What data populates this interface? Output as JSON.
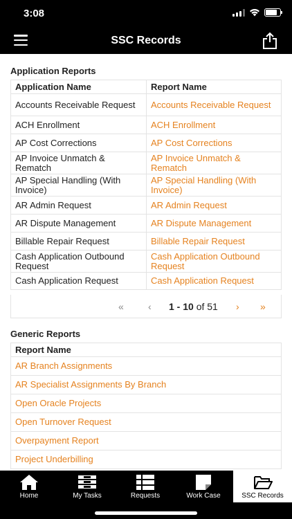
{
  "status": {
    "time": "3:08"
  },
  "nav": {
    "title": "SSC Records"
  },
  "app_reports": {
    "title": "Application Reports",
    "columns": [
      "Application Name",
      "Report Name"
    ],
    "rows": [
      [
        "Accounts Receivable Request",
        "Accounts Receivable Request"
      ],
      [
        "ACH Enrollment",
        "ACH Enrollment"
      ],
      [
        "AP Cost Corrections",
        "AP Cost Corrections"
      ],
      [
        "AP Invoice Unmatch & Rematch",
        "AP Invoice Unmatch & Rematch"
      ],
      [
        "AP Special Handling (With Invoice)",
        "AP Special Handling (With Invoice)"
      ],
      [
        "AR Admin Request",
        "AR Admin Request"
      ],
      [
        "AR Dispute Management",
        "AR Dispute Management"
      ],
      [
        "Billable Repair Request",
        "Billable Repair Request"
      ],
      [
        "Cash Application Outbound Request",
        "Cash Application Outbound Request"
      ],
      [
        "Cash Application Request",
        "Cash Application Request"
      ]
    ]
  },
  "pager": {
    "first": "«",
    "prev": "‹",
    "range": "1 - 10",
    "of_text": "of 51",
    "next": "›",
    "last": "»"
  },
  "generic_reports": {
    "title": "Generic Reports",
    "column": "Report Name",
    "rows": [
      "AR Branch Assignments",
      "AR Specialist Assignments By Branch",
      "Open Oracle Projects",
      "Open Turnover Request",
      "Overpayment Report",
      "Project Underbilling"
    ]
  },
  "tabs": [
    {
      "label": "Home",
      "icon": "home-icon"
    },
    {
      "label": "My Tasks",
      "icon": "tasks-icon"
    },
    {
      "label": "Requests",
      "icon": "requests-icon"
    },
    {
      "label": "Work Case",
      "icon": "work-case-icon"
    },
    {
      "label": "SSC Records",
      "icon": "folder-open-icon",
      "active": true
    }
  ],
  "colors": {
    "accent": "#e5821f",
    "bar": "#000000"
  }
}
